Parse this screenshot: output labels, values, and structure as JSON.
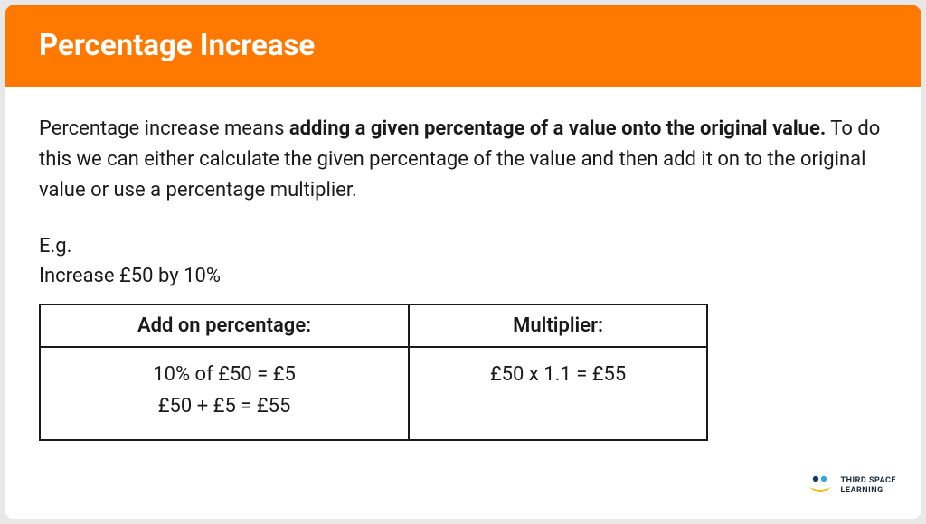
{
  "header": {
    "title": "Percentage Increase"
  },
  "body": {
    "desc_prefix": "Percentage increase means ",
    "desc_bold": "adding a given percentage of a value onto the original value.",
    "desc_suffix": " To do this we can either calculate the given percentage of the value and then add it on to the original value or use a percentage multiplier.",
    "example_label": "E.g.",
    "example_text": "Increase £50 by 10%"
  },
  "table": {
    "headers": [
      "Add on percentage:",
      "Multiplier:"
    ],
    "col1": {
      "line1": "10% of £50 = £5",
      "line2": "£50 + £5 = £55"
    },
    "col2": {
      "line1": "£50 x 1.1 = £55"
    }
  },
  "logo": {
    "line1": "THIRD SPACE",
    "line2": "LEARNING"
  }
}
